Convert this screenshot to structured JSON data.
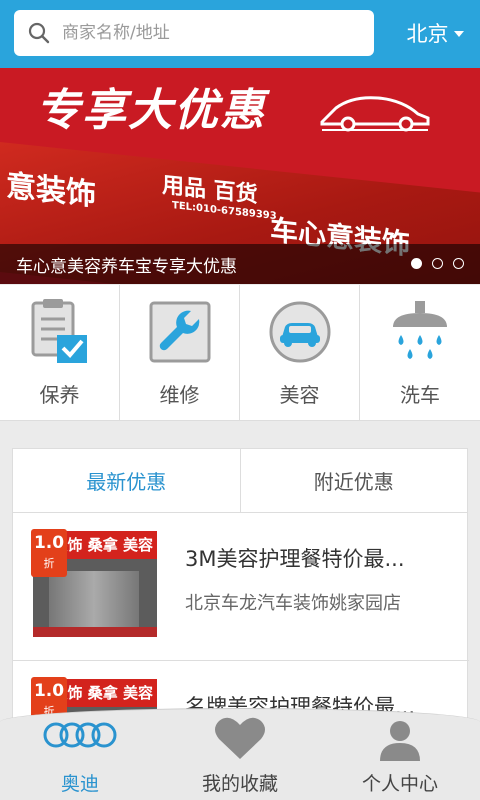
{
  "search": {
    "placeholder": "商家名称/地址"
  },
  "city": {
    "label": "北京"
  },
  "banner": {
    "headline": "专享大优惠",
    "caption": "车心意美容养车宝专享大优惠",
    "slides": 3,
    "active_slide": 1,
    "shop_sign": [
      "意装饰",
      "用品 百货",
      "车心意装饰",
      "TEL:010-67589393"
    ]
  },
  "services": [
    {
      "label": "保养",
      "icon": "clipboard-check-icon"
    },
    {
      "label": "维修",
      "icon": "wrench-icon"
    },
    {
      "label": "美容",
      "icon": "car-icon"
    },
    {
      "label": "洗车",
      "icon": "shower-icon"
    }
  ],
  "deals": {
    "tabs": [
      {
        "label": "最新优惠",
        "active": true
      },
      {
        "label": "附近优惠",
        "active": false
      }
    ],
    "items": [
      {
        "title": "3M美容护理餐特价最...",
        "shop": "北京车龙汽车装饰姚家园店",
        "discount": "1.0",
        "unit": "折",
        "sign": "装饰 桑拿 美容"
      },
      {
        "title": "名牌美容护理餐特价最...",
        "shop": "",
        "discount": "1.0",
        "unit": "折",
        "sign": "装饰 桑拿 美容"
      }
    ]
  },
  "nav": [
    {
      "label": "奥迪",
      "icon": "audi-rings-icon",
      "active": true
    },
    {
      "label": "我的收藏",
      "icon": "heart-icon",
      "active": false
    },
    {
      "label": "个人中心",
      "icon": "person-icon",
      "active": false
    }
  ],
  "colors": {
    "primary": "#2aa4dc",
    "accent_text": "#2a93cf",
    "banner": "#c91a23",
    "badge": "#e3401a"
  }
}
